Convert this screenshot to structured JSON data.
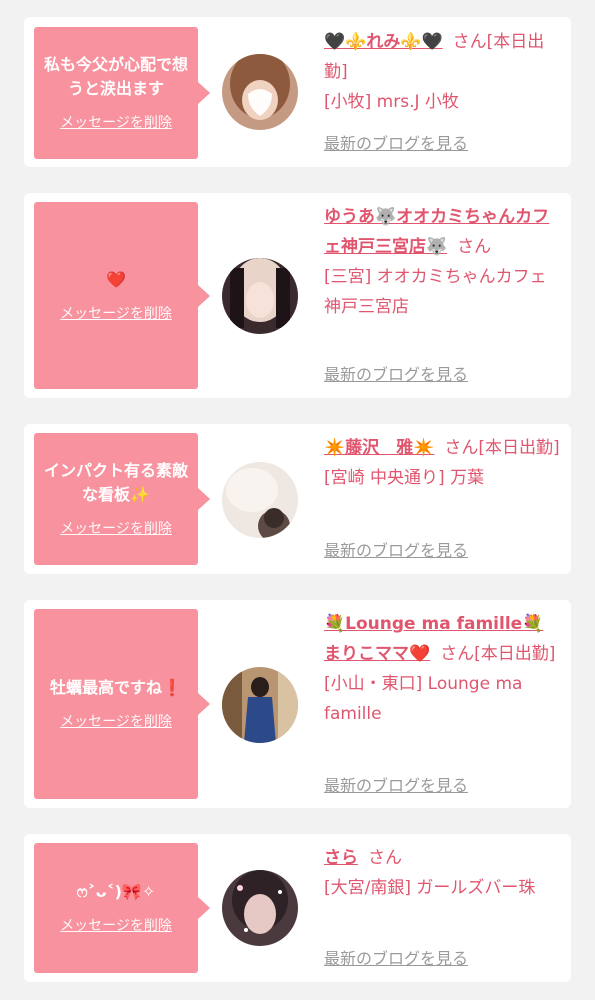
{
  "delete_label": "メッセージを削除",
  "blog_label": "最新のブログを見る",
  "colors": {
    "accent_pink": "#f8929e",
    "name_color": "#e0566e",
    "muted_link": "#9a9a9a",
    "page_bg": "#f2f2f2"
  },
  "cards": [
    {
      "message": "私も今父が心配で想うと涙出ます",
      "name": "🖤⚜️れみ⚜️🖤",
      "honorific": "さん",
      "status": "[本日出勤]",
      "store": "[小牧] mrs.J 小牧"
    },
    {
      "message": "❤️",
      "name": "ゆうあ🐺オオカミちゃんカフェ神戸三宮店🐺",
      "honorific": "さん",
      "status": "",
      "store": "[三宮] オオカミちゃんカフェ神戸三宮店"
    },
    {
      "message": "インパクト有る素敵な看板✨",
      "name": "✴️藤沢　雅✴️",
      "honorific": "さん",
      "status": "[本日出勤]",
      "store": "[宮崎 中央通り] 万葉"
    },
    {
      "message": "牡蠣最高ですね❗️",
      "name": "💐Lounge ma famille💐まりこママ❤️",
      "honorific": "さん",
      "status": "[本日出勤]",
      "store": "[小山・東口] Lounge ma famille"
    },
    {
      "message": "ෆ˃ᴗ˂)🎀✧",
      "name": "さら",
      "honorific": "さん",
      "status": "",
      "store": "[大宮/南銀] ガールズバー珠"
    }
  ]
}
